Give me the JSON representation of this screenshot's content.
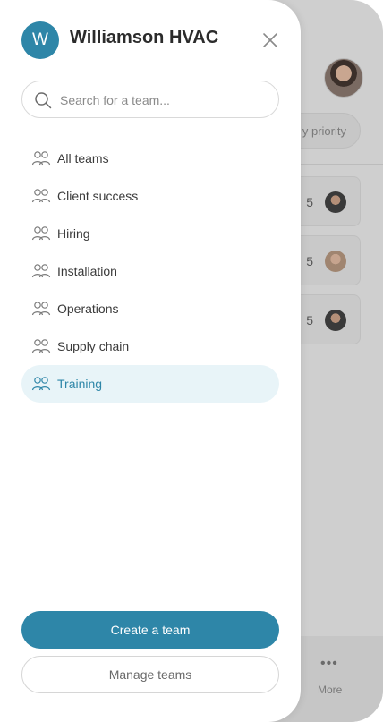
{
  "background": {
    "filter_chip": "y priority",
    "cards": [
      {
        "count": "5"
      },
      {
        "count": "5"
      },
      {
        "count": "5"
      }
    ],
    "tabbar": {
      "more_label": "More",
      "more_icon": "ellipsis-icon"
    }
  },
  "drawer": {
    "org_initial": "W",
    "org_name": "Williamson HVAC",
    "close_icon": "close-icon",
    "search": {
      "placeholder": "Search for a team..."
    },
    "teams": [
      {
        "label": "All teams",
        "active": false
      },
      {
        "label": "Client success",
        "active": false
      },
      {
        "label": "Hiring",
        "active": false
      },
      {
        "label": "Installation",
        "active": false
      },
      {
        "label": "Operations",
        "active": false
      },
      {
        "label": "Supply chain",
        "active": false
      },
      {
        "label": "Training",
        "active": true
      }
    ],
    "create_label": "Create a team",
    "manage_label": "Manage teams"
  },
  "colors": {
    "accent": "#2e86a8",
    "active_bg": "#e8f4f8",
    "overlay": "#cfcfcf"
  }
}
